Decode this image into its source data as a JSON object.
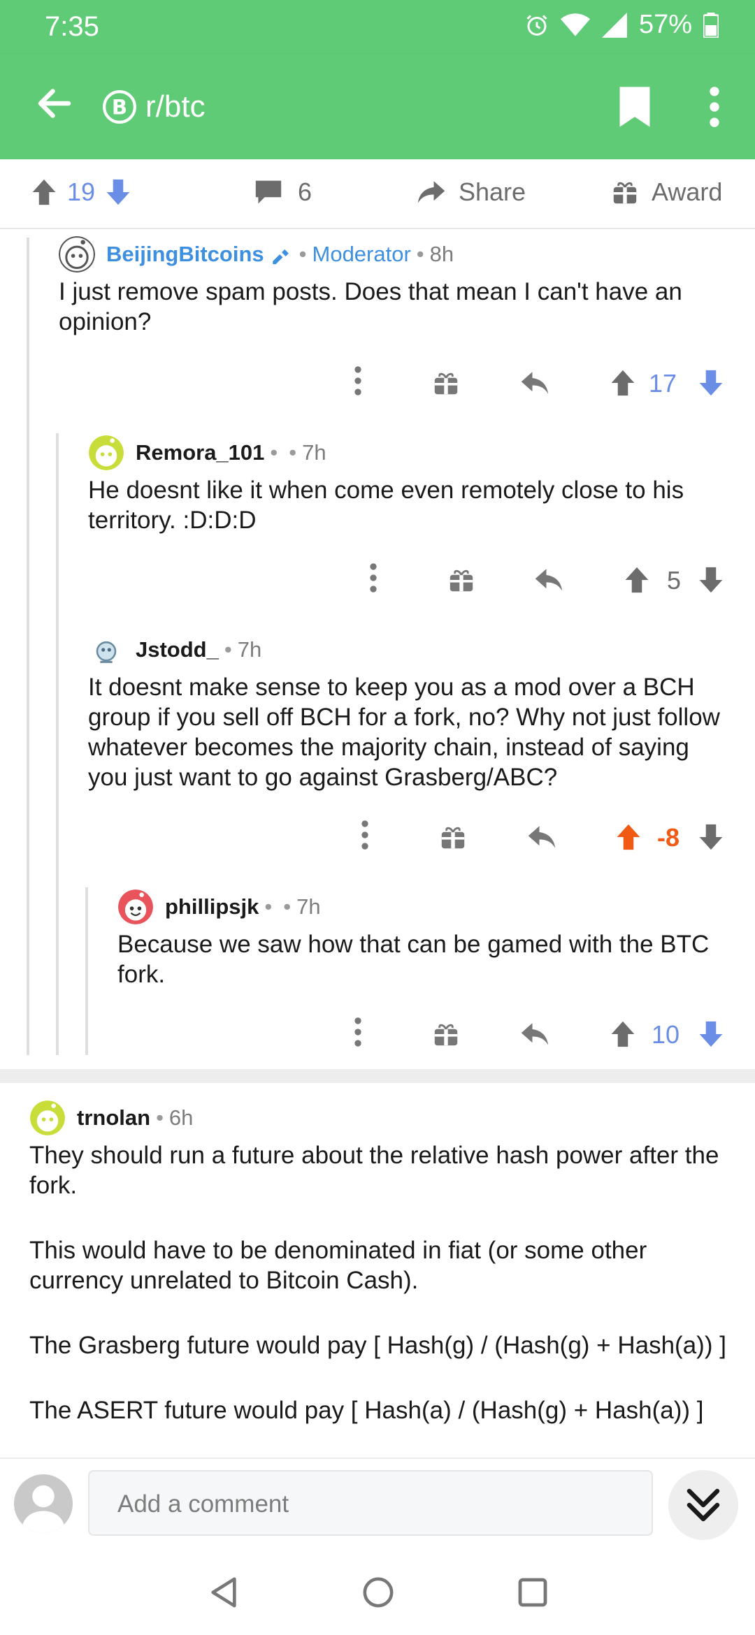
{
  "status_bar": {
    "time": "7:35",
    "battery": "57%"
  },
  "app_bar": {
    "subreddit": "r/btc"
  },
  "post_actions": {
    "score": "19",
    "comments": "6",
    "share_label": "Share",
    "award_label": "Award"
  },
  "comments": [
    {
      "author": "BeijingBitcoins",
      "role": "Moderator",
      "age": "8h",
      "body": "I just remove spam posts. Does that mean I can't have an opinion?",
      "score": "17"
    },
    {
      "author": "Remora_101",
      "age": "7h",
      "body": "He doesnt like it when come even remotely close to his territory. :D:D:D",
      "score": "5"
    },
    {
      "author": "Jstodd_",
      "age": "7h",
      "body": "It doesnt make sense to keep you as a mod over a BCH group if you sell off BCH for a fork, no? Why not just follow whatever becomes the majority chain, instead of saying you just want to go against Grasberg/ABC?",
      "score": "-8"
    },
    {
      "author": "phillipsjk",
      "age": "7h",
      "body": "Because we saw how that can be gamed with the BTC fork.",
      "score": "10"
    },
    {
      "author": "trnolan",
      "age": "6h",
      "paragraphs": [
        "They should run a future about the relative hash power after the fork.",
        "This would have to be denominated in fiat (or some other currency unrelated to Bitcoin Cash).",
        "The Grasberg future would pay [ Hash(g) / (Hash(g) + Hash(a)) ]",
        "The ASERT future would pay [ Hash(a) / (Hash(g) + Hash(a)) ]"
      ]
    }
  ],
  "comment_input": {
    "placeholder": "Add a comment"
  },
  "colors": {
    "app_green": "#5fcb76",
    "upvote_blue": "#6a8de6",
    "upvote_orange": "#f05a14",
    "mod_blue": "#3d8fe0"
  },
  "icons": {
    "back": "arrow-left-icon",
    "bookmark": "bookmark-icon",
    "more": "more-vertical-icon",
    "upvote": "arrow-up-icon",
    "downvote": "arrow-down-icon",
    "comments": "comment-bubble-icon",
    "share": "share-arrow-icon",
    "award": "gift-icon",
    "reply": "reply-icon"
  }
}
